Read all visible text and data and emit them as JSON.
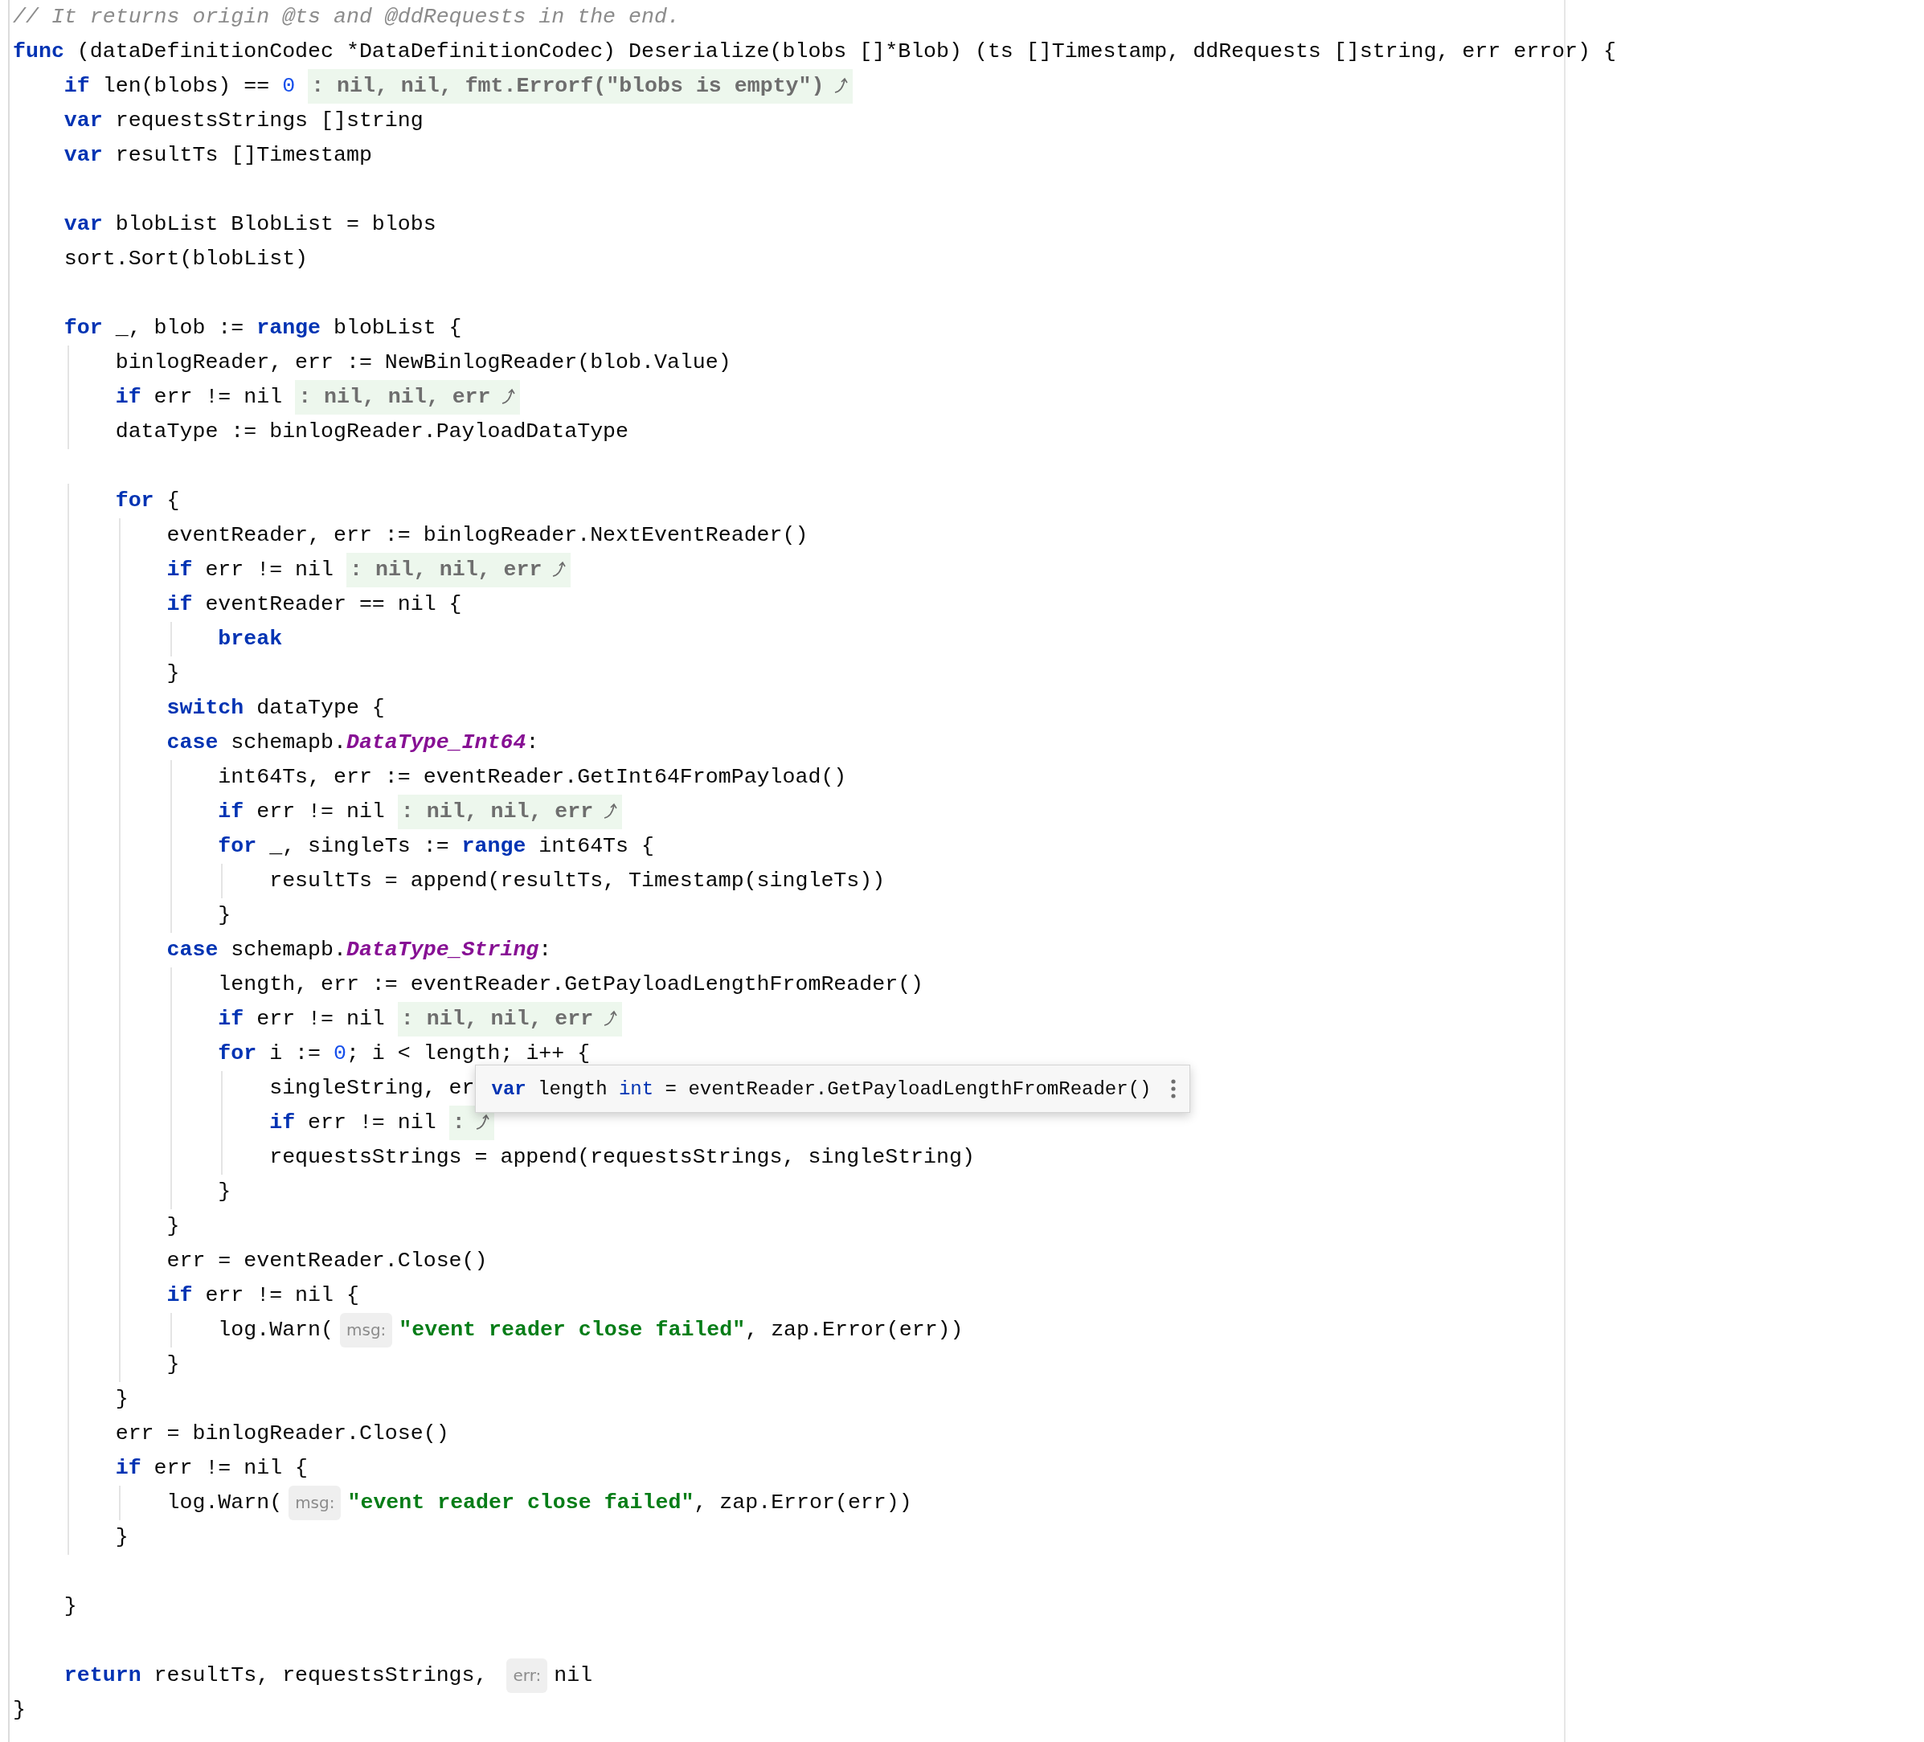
{
  "editor": {
    "lines": [
      {
        "kind": "code",
        "tokens": [
          {
            "kind": "comment",
            "text": "// It returns origin @ts and @ddRequests in the end."
          }
        ]
      },
      {
        "kind": "code",
        "tokens": [
          {
            "kind": "keyword",
            "text": "func"
          },
          {
            "kind": "plain",
            "text": " (dataDefinitionCodec *DataDefinitionCodec) Deserialize(blobs []*Blob) (ts []Timestamp, ddRequests []string, err error) {"
          }
        ]
      },
      {
        "kind": "code",
        "tokens": [
          {
            "kind": "keyword",
            "text": "    if"
          },
          {
            "kind": "plain",
            "text": " len(blobs) == "
          },
          {
            "kind": "number",
            "text": "0"
          },
          {
            "kind": "fold",
            "text": ": nil, nil, fmt.Errorf(\"blobs is empty\")"
          }
        ]
      },
      {
        "kind": "code",
        "tokens": [
          {
            "kind": "keyword",
            "text": "    var"
          },
          {
            "kind": "plain",
            "text": " requestsStrings []string"
          }
        ]
      },
      {
        "kind": "code",
        "tokens": [
          {
            "kind": "keyword",
            "text": "    var"
          },
          {
            "kind": "plain",
            "text": " resultTs []Timestamp"
          }
        ]
      },
      {
        "kind": "blank"
      },
      {
        "kind": "code",
        "tokens": [
          {
            "kind": "keyword",
            "text": "    var"
          },
          {
            "kind": "plain",
            "text": " blobList BlobList = blobs"
          }
        ]
      },
      {
        "kind": "code",
        "tokens": [
          {
            "kind": "plain",
            "text": "    sort.Sort(blobList)"
          }
        ]
      },
      {
        "kind": "blank"
      },
      {
        "kind": "code",
        "tokens": [
          {
            "kind": "keyword",
            "text": "    for"
          },
          {
            "kind": "plain",
            "text": " _, blob := "
          },
          {
            "kind": "keyword",
            "text": "range"
          },
          {
            "kind": "plain",
            "text": " blobList {"
          }
        ]
      },
      {
        "kind": "code",
        "tokens": [
          {
            "kind": "plain",
            "text": "        binlogReader, err := NewBinlogReader(blob.Value)"
          }
        ]
      },
      {
        "kind": "code",
        "tokens": [
          {
            "kind": "keyword",
            "text": "        if"
          },
          {
            "kind": "plain",
            "text": " err != nil"
          },
          {
            "kind": "fold",
            "text": ": nil, nil, err"
          }
        ]
      },
      {
        "kind": "code",
        "tokens": [
          {
            "kind": "plain",
            "text": "        dataType := binlogReader.PayloadDataType"
          }
        ]
      },
      {
        "kind": "blank"
      },
      {
        "kind": "code",
        "tokens": [
          {
            "kind": "keyword",
            "text": "        for"
          },
          {
            "kind": "plain",
            "text": " {"
          }
        ]
      },
      {
        "kind": "code",
        "tokens": [
          {
            "kind": "plain",
            "text": "            eventReader, err := binlogReader.NextEventReader()"
          }
        ]
      },
      {
        "kind": "code",
        "tokens": [
          {
            "kind": "keyword",
            "text": "            if"
          },
          {
            "kind": "plain",
            "text": " err != nil"
          },
          {
            "kind": "fold",
            "text": ": nil, nil, err"
          }
        ]
      },
      {
        "kind": "code",
        "tokens": [
          {
            "kind": "keyword",
            "text": "            if"
          },
          {
            "kind": "plain",
            "text": " eventReader == nil {"
          }
        ]
      },
      {
        "kind": "code",
        "tokens": [
          {
            "kind": "keyword",
            "text": "                break"
          }
        ]
      },
      {
        "kind": "code",
        "tokens": [
          {
            "kind": "plain",
            "text": "            }"
          }
        ]
      },
      {
        "kind": "code",
        "tokens": [
          {
            "kind": "keyword",
            "text": "            switch"
          },
          {
            "kind": "plain",
            "text": " dataType {"
          }
        ]
      },
      {
        "kind": "code",
        "tokens": [
          {
            "kind": "keyword",
            "text": "            case"
          },
          {
            "kind": "plain",
            "text": " schemapb."
          },
          {
            "kind": "type",
            "text": "DataType_Int64"
          },
          {
            "kind": "plain",
            "text": ":"
          }
        ]
      },
      {
        "kind": "code",
        "tokens": [
          {
            "kind": "plain",
            "text": "                int64Ts, err := eventReader.GetInt64FromPayload()"
          }
        ]
      },
      {
        "kind": "code",
        "tokens": [
          {
            "kind": "keyword",
            "text": "                if"
          },
          {
            "kind": "plain",
            "text": " err != nil"
          },
          {
            "kind": "fold",
            "text": ": nil, nil, err"
          }
        ]
      },
      {
        "kind": "code",
        "tokens": [
          {
            "kind": "keyword",
            "text": "                for"
          },
          {
            "kind": "plain",
            "text": " _, singleTs := "
          },
          {
            "kind": "keyword",
            "text": "range"
          },
          {
            "kind": "plain",
            "text": " int64Ts {"
          }
        ]
      },
      {
        "kind": "code",
        "tokens": [
          {
            "kind": "plain",
            "text": "                    resultTs = append(resultTs, Timestamp(singleTs))"
          }
        ]
      },
      {
        "kind": "code",
        "tokens": [
          {
            "kind": "plain",
            "text": "                }"
          }
        ]
      },
      {
        "kind": "code",
        "tokens": [
          {
            "kind": "keyword",
            "text": "            case"
          },
          {
            "kind": "plain",
            "text": " schemapb."
          },
          {
            "kind": "type",
            "text": "DataType_String"
          },
          {
            "kind": "plain",
            "text": ":"
          }
        ]
      },
      {
        "kind": "code",
        "tokens": [
          {
            "kind": "plain",
            "text": "                length, err := eventReader.GetPayloadLengthFromReader()"
          }
        ]
      },
      {
        "kind": "code",
        "tokens": [
          {
            "kind": "keyword",
            "text": "                if"
          },
          {
            "kind": "plain",
            "text": " err != nil"
          },
          {
            "kind": "fold",
            "text": ": nil, nil, err"
          }
        ]
      },
      {
        "kind": "code",
        "tokens": [
          {
            "kind": "keyword",
            "text": "                for"
          },
          {
            "kind": "plain",
            "text": " i := "
          },
          {
            "kind": "number",
            "text": "0"
          },
          {
            "kind": "plain",
            "text": "; i < length; i++ {"
          }
        ]
      },
      {
        "kind": "code",
        "tokens": [
          {
            "kind": "plain",
            "text": "                    singleString, er"
          }
        ],
        "tooltip": {
          "tokens": [
            {
              "kind": "keyword",
              "text": "var"
            },
            {
              "kind": "plain",
              "text": " length "
            },
            {
              "kind": "builtin",
              "text": "int"
            },
            {
              "kind": "plain",
              "text": " = eventReader.GetPayloadLengthFromReader()"
            }
          ]
        }
      },
      {
        "kind": "code",
        "tokens": [
          {
            "kind": "keyword",
            "text": "                    if"
          },
          {
            "kind": "plain",
            "text": " err != nil"
          },
          {
            "kind": "fold",
            "text": ":"
          }
        ]
      },
      {
        "kind": "code",
        "tokens": [
          {
            "kind": "plain",
            "text": "                    requestsStrings = append(requestsStrings, singleString)"
          }
        ]
      },
      {
        "kind": "code",
        "tokens": [
          {
            "kind": "plain",
            "text": "                }"
          }
        ]
      },
      {
        "kind": "code",
        "tokens": [
          {
            "kind": "plain",
            "text": "            }"
          }
        ]
      },
      {
        "kind": "code",
        "tokens": [
          {
            "kind": "plain",
            "text": "            err = eventReader.Close()"
          }
        ]
      },
      {
        "kind": "code",
        "tokens": [
          {
            "kind": "keyword",
            "text": "            if"
          },
          {
            "kind": "plain",
            "text": " err != nil {"
          }
        ]
      },
      {
        "kind": "code",
        "tokens": [
          {
            "kind": "plain",
            "text": "                log.Warn("
          },
          {
            "kind": "hint",
            "text": "msg:"
          },
          {
            "kind": "string",
            "text": "\"event reader close failed\""
          },
          {
            "kind": "plain",
            "text": ", zap.Error(err))"
          }
        ]
      },
      {
        "kind": "code",
        "tokens": [
          {
            "kind": "plain",
            "text": "            }"
          }
        ]
      },
      {
        "kind": "code",
        "tokens": [
          {
            "kind": "plain",
            "text": "        }"
          }
        ]
      },
      {
        "kind": "code",
        "tokens": [
          {
            "kind": "plain",
            "text": "        err = binlogReader.Close()"
          }
        ]
      },
      {
        "kind": "code",
        "tokens": [
          {
            "kind": "keyword",
            "text": "        if"
          },
          {
            "kind": "plain",
            "text": " err != nil {"
          }
        ]
      },
      {
        "kind": "code",
        "tokens": [
          {
            "kind": "plain",
            "text": "            log.Warn("
          },
          {
            "kind": "hint",
            "text": "msg:"
          },
          {
            "kind": "string",
            "text": "\"event reader close failed\""
          },
          {
            "kind": "plain",
            "text": ", zap.Error(err))"
          }
        ]
      },
      {
        "kind": "code",
        "tokens": [
          {
            "kind": "plain",
            "text": "        }"
          }
        ]
      },
      {
        "kind": "blank"
      },
      {
        "kind": "code",
        "tokens": [
          {
            "kind": "plain",
            "text": "    }"
          }
        ]
      },
      {
        "kind": "blank"
      },
      {
        "kind": "code",
        "tokens": [
          {
            "kind": "keyword",
            "text": "    return"
          },
          {
            "kind": "plain",
            "text": " resultTs, requestsStrings, "
          },
          {
            "kind": "hint",
            "text": "err:"
          },
          {
            "kind": "plain",
            "text": "nil"
          }
        ]
      },
      {
        "kind": "code",
        "tokens": [
          {
            "kind": "plain",
            "text": "}"
          }
        ]
      }
    ]
  }
}
